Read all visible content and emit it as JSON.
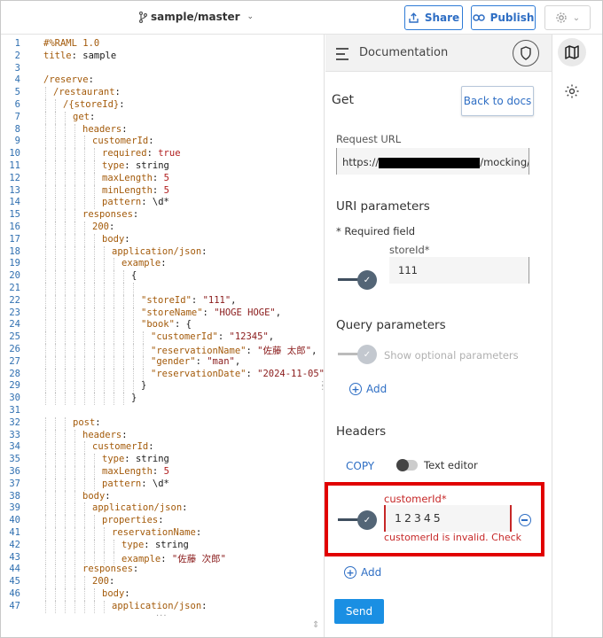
{
  "topbar": {
    "branch": "sample/master",
    "share_label": "Share",
    "publish_label": "Publish"
  },
  "editor": {
    "lines": [
      {
        "n": "1",
        "indent": 0,
        "parts": [
          [
            "k",
            "#%RAML 1.0"
          ]
        ]
      },
      {
        "n": "2",
        "indent": 0,
        "parts": [
          [
            "k",
            "title"
          ],
          [
            "v",
            ": sample"
          ]
        ]
      },
      {
        "n": "3",
        "indent": 0,
        "parts": []
      },
      {
        "n": "4",
        "indent": 0,
        "parts": [
          [
            "k",
            "/reserve"
          ],
          [
            "v",
            ":"
          ]
        ]
      },
      {
        "n": "5",
        "indent": 1,
        "parts": [
          [
            "k",
            "/restaurant"
          ],
          [
            "v",
            ":"
          ]
        ]
      },
      {
        "n": "6",
        "indent": 2,
        "parts": [
          [
            "k",
            "/{storeId}"
          ],
          [
            "v",
            ":"
          ]
        ]
      },
      {
        "n": "7",
        "indent": 3,
        "parts": [
          [
            "k",
            "get"
          ],
          [
            "v",
            ":"
          ]
        ]
      },
      {
        "n": "8",
        "indent": 4,
        "parts": [
          [
            "k",
            "headers"
          ],
          [
            "v",
            ":"
          ]
        ]
      },
      {
        "n": "9",
        "indent": 5,
        "parts": [
          [
            "k",
            "customerId"
          ],
          [
            "v",
            ":"
          ]
        ]
      },
      {
        "n": "10",
        "indent": 6,
        "parts": [
          [
            "k",
            "required"
          ],
          [
            "v",
            ": "
          ],
          [
            "b",
            "true"
          ]
        ]
      },
      {
        "n": "11",
        "indent": 6,
        "parts": [
          [
            "k",
            "type"
          ],
          [
            "v",
            ": string"
          ]
        ]
      },
      {
        "n": "12",
        "indent": 6,
        "parts": [
          [
            "k",
            "maxLength"
          ],
          [
            "v",
            ": "
          ],
          [
            "b",
            "5"
          ]
        ]
      },
      {
        "n": "13",
        "indent": 6,
        "parts": [
          [
            "k",
            "minLength"
          ],
          [
            "v",
            ": "
          ],
          [
            "b",
            "5"
          ]
        ]
      },
      {
        "n": "14",
        "indent": 6,
        "parts": [
          [
            "k",
            "pattern"
          ],
          [
            "v",
            ": \\d*"
          ]
        ]
      },
      {
        "n": "15",
        "indent": 4,
        "parts": [
          [
            "k",
            "responses"
          ],
          [
            "v",
            ":"
          ]
        ]
      },
      {
        "n": "16",
        "indent": 5,
        "parts": [
          [
            "k",
            "200"
          ],
          [
            "v",
            ":"
          ]
        ]
      },
      {
        "n": "17",
        "indent": 6,
        "parts": [
          [
            "k",
            "body"
          ],
          [
            "v",
            ":"
          ]
        ]
      },
      {
        "n": "18",
        "indent": 7,
        "parts": [
          [
            "k",
            "application/json"
          ],
          [
            "v",
            ":"
          ]
        ]
      },
      {
        "n": "19",
        "indent": 8,
        "parts": [
          [
            "k",
            "example"
          ],
          [
            "v",
            ":"
          ]
        ]
      },
      {
        "n": "20",
        "indent": 9,
        "parts": [
          [
            "v",
            "{"
          ]
        ]
      },
      {
        "n": "21",
        "indent": 10,
        "parts": []
      },
      {
        "n": "22",
        "indent": 10,
        "parts": [
          [
            "k",
            "\"storeId\""
          ],
          [
            "v",
            ": "
          ],
          [
            "s",
            "\"111\""
          ],
          [
            "v",
            ","
          ]
        ]
      },
      {
        "n": "23",
        "indent": 10,
        "parts": [
          [
            "k",
            "\"storeName\""
          ],
          [
            "v",
            ": "
          ],
          [
            "s",
            "\"HOGE HOGE\""
          ],
          [
            "v",
            ","
          ]
        ]
      },
      {
        "n": "24",
        "indent": 10,
        "parts": [
          [
            "k",
            "\"book\""
          ],
          [
            "v",
            ": {"
          ]
        ]
      },
      {
        "n": "25",
        "indent": 11,
        "parts": [
          [
            "k",
            "\"customerId\""
          ],
          [
            "v",
            ": "
          ],
          [
            "s",
            "\"12345\""
          ],
          [
            "v",
            ","
          ]
        ]
      },
      {
        "n": "26",
        "indent": 11,
        "parts": [
          [
            "k",
            "\"reservationName\""
          ],
          [
            "v",
            ": "
          ],
          [
            "s",
            "\"佐藤 太郎\""
          ],
          [
            "v",
            ","
          ]
        ]
      },
      {
        "n": "27",
        "indent": 11,
        "parts": [
          [
            "k",
            "\"gender\""
          ],
          [
            "v",
            ": "
          ],
          [
            "s",
            "\"man\""
          ],
          [
            "v",
            ","
          ]
        ]
      },
      {
        "n": "28",
        "indent": 11,
        "parts": [
          [
            "k",
            "\"reservationDate\""
          ],
          [
            "v",
            ": "
          ],
          [
            "s",
            "\"2024-11-05\""
          ],
          [
            "v",
            ","
          ]
        ]
      },
      {
        "n": "29",
        "indent": 10,
        "parts": [
          [
            "v",
            "}"
          ]
        ]
      },
      {
        "n": "30",
        "indent": 9,
        "parts": [
          [
            "v",
            "}"
          ]
        ]
      },
      {
        "n": "31",
        "indent": 0,
        "parts": []
      },
      {
        "n": "32",
        "indent": 3,
        "parts": [
          [
            "k",
            "post"
          ],
          [
            "v",
            ":"
          ]
        ]
      },
      {
        "n": "33",
        "indent": 4,
        "parts": [
          [
            "k",
            "headers"
          ],
          [
            "v",
            ":"
          ]
        ]
      },
      {
        "n": "34",
        "indent": 5,
        "parts": [
          [
            "k",
            "customerId"
          ],
          [
            "v",
            ":"
          ]
        ]
      },
      {
        "n": "35",
        "indent": 6,
        "parts": [
          [
            "k",
            "type"
          ],
          [
            "v",
            ": string"
          ]
        ]
      },
      {
        "n": "36",
        "indent": 6,
        "parts": [
          [
            "k",
            "maxLength"
          ],
          [
            "v",
            ": "
          ],
          [
            "b",
            "5"
          ]
        ]
      },
      {
        "n": "37",
        "indent": 6,
        "parts": [
          [
            "k",
            "pattern"
          ],
          [
            "v",
            ": \\d*"
          ]
        ]
      },
      {
        "n": "38",
        "indent": 4,
        "parts": [
          [
            "k",
            "body"
          ],
          [
            "v",
            ":"
          ]
        ]
      },
      {
        "n": "39",
        "indent": 5,
        "parts": [
          [
            "k",
            "application/json"
          ],
          [
            "v",
            ":"
          ]
        ]
      },
      {
        "n": "40",
        "indent": 6,
        "parts": [
          [
            "k",
            "properties"
          ],
          [
            "v",
            ":"
          ]
        ]
      },
      {
        "n": "41",
        "indent": 7,
        "parts": [
          [
            "k",
            "reservationName"
          ],
          [
            "v",
            ":"
          ]
        ]
      },
      {
        "n": "42",
        "indent": 8,
        "parts": [
          [
            "k",
            "type"
          ],
          [
            "v",
            ": string"
          ]
        ]
      },
      {
        "n": "43",
        "indent": 8,
        "parts": [
          [
            "k",
            "example"
          ],
          [
            "v",
            ": "
          ],
          [
            "s",
            "\"佐藤 次郎\""
          ]
        ]
      },
      {
        "n": "44",
        "indent": 4,
        "parts": [
          [
            "k",
            "responses"
          ],
          [
            "v",
            ":"
          ]
        ]
      },
      {
        "n": "45",
        "indent": 5,
        "parts": [
          [
            "k",
            "200"
          ],
          [
            "v",
            ":"
          ]
        ]
      },
      {
        "n": "46",
        "indent": 6,
        "parts": [
          [
            "k",
            "body"
          ],
          [
            "v",
            ":"
          ]
        ]
      },
      {
        "n": "47",
        "indent": 7,
        "parts": [
          [
            "k",
            "application/json"
          ],
          [
            "v",
            ":"
          ]
        ]
      }
    ]
  },
  "doc": {
    "title": "Documentation",
    "method": "Get",
    "back_label": "Back to docs",
    "request_url_label": "Request URL",
    "url_prefix": "https://",
    "url_suffix": "/mocking/",
    "uri_params_title": "URI parameters",
    "required_note": "* Required field",
    "storeid_label": "storeId*",
    "storeid_value": "111",
    "query_title": "Query parameters",
    "optional_label": "Show optional parameters",
    "add_label": "Add",
    "headers_title": "Headers",
    "copy_label": "COPY",
    "text_editor_label": "Text editor",
    "customerid_label": "customerId*",
    "customerid_value": "12345",
    "error_text": "customerId is invalid. Check",
    "add_header_label": "Add",
    "send_label": "Send"
  },
  "colors": {
    "accent": "#2e6ec4",
    "error": "#c62828",
    "highlight": "#e10000",
    "send": "#1a8fe3"
  }
}
